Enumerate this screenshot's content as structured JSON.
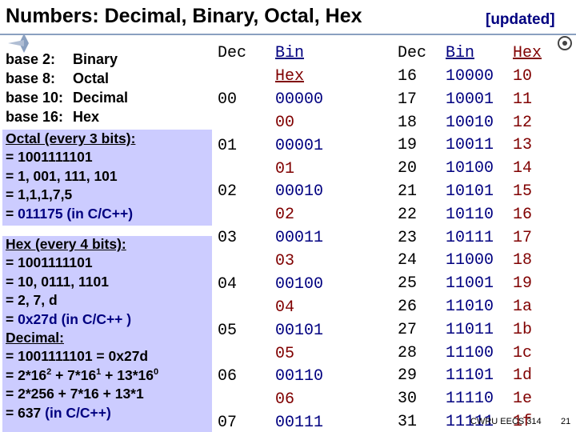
{
  "title": "Numbers: Decimal, Binary, Octal, Hex",
  "updated": "[updated]",
  "bases": [
    {
      "key": "base 2:",
      "name": "Binary"
    },
    {
      "key": "base 8:",
      "name": "Octal"
    },
    {
      "key": "base 10:",
      "name": "Decimal"
    },
    {
      "key": "base 16:",
      "name": "Hex"
    }
  ],
  "octal_note": {
    "heading": "Octal (every 3 bits):",
    "lines": [
      "= 1001111101",
      "= 1, 001, 111, 101",
      "= 1,1,1,7,5"
    ],
    "result_prefix": "= ",
    "result": "011175 (in C/C++)"
  },
  "hex_note": {
    "heading": "Hex (every 4 bits):",
    "lines": [
      "= 1001111101",
      "= 10, 0111, 1101",
      "= 2, 7, d"
    ],
    "result_prefix": "= ",
    "result": "0x27d (in C/C++ )"
  },
  "decimal_note": {
    "heading": "Decimal:",
    "line1": "= 1001111101 = 0x27d",
    "line2_parts": [
      "= 2*16",
      "2",
      " + 7*16",
      "1",
      " + 13*16",
      "0"
    ],
    "line3": "= 2*256 + 7*16 + 13*1",
    "result_prefix": "= 637 ",
    "result": "(in C/C++)"
  },
  "table_left": {
    "headers": {
      "dec": "Dec",
      "bin": "Bin",
      "hex": "Hex"
    },
    "rows": [
      {
        "dec": "00",
        "bin": "00000",
        "hex": "00"
      },
      {
        "dec": "01",
        "bin": "00001",
        "hex": "01"
      },
      {
        "dec": "02",
        "bin": "00010",
        "hex": "02"
      },
      {
        "dec": "03",
        "bin": "00011",
        "hex": "03"
      },
      {
        "dec": "04",
        "bin": "00100",
        "hex": "04"
      },
      {
        "dec": "05",
        "bin": "00101",
        "hex": "05"
      },
      {
        "dec": "06",
        "bin": "00110",
        "hex": "06"
      },
      {
        "dec": "07",
        "bin": "00111",
        "hex": ""
      }
    ]
  },
  "table_right": {
    "headers": {
      "dec": "Dec",
      "bin": "Bin",
      "hex": "Hex"
    },
    "rows": [
      {
        "dec": "16",
        "bin": "10000",
        "hex": "10"
      },
      {
        "dec": "17",
        "bin": "10001",
        "hex": "11"
      },
      {
        "dec": "18",
        "bin": "10010",
        "hex": "12"
      },
      {
        "dec": "19",
        "bin": "10011",
        "hex": "13"
      },
      {
        "dec": "20",
        "bin": "10100",
        "hex": "14"
      },
      {
        "dec": "21",
        "bin": "10101",
        "hex": "15"
      },
      {
        "dec": "22",
        "bin": "10110",
        "hex": "16"
      },
      {
        "dec": "23",
        "bin": "10111",
        "hex": "17"
      },
      {
        "dec": "24",
        "bin": "11000",
        "hex": "18"
      },
      {
        "dec": "25",
        "bin": "11001",
        "hex": "19"
      },
      {
        "dec": "26",
        "bin": "11010",
        "hex": "1a"
      },
      {
        "dec": "27",
        "bin": "11011",
        "hex": "1b"
      },
      {
        "dec": "28",
        "bin": "11100",
        "hex": "1c"
      },
      {
        "dec": "29",
        "bin": "11101",
        "hex": "1d"
      },
      {
        "dec": "30",
        "bin": "11110",
        "hex": "1e"
      },
      {
        "dec": "31",
        "bin": "11111",
        "hex": "1f"
      }
    ]
  },
  "footer": {
    "course": "CWRU EECS 314",
    "page": "21"
  },
  "colors": {
    "note_background": "#ccccff",
    "accent_text": "#000080",
    "hex_column": "#800000"
  }
}
